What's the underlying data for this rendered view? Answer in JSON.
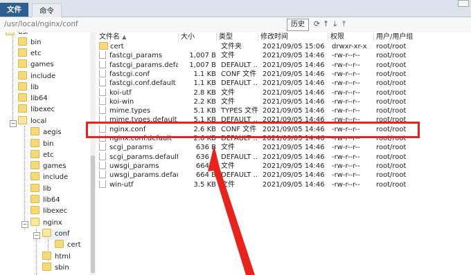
{
  "tabs": [
    {
      "label": "文件"
    },
    {
      "label": "命令"
    }
  ],
  "pathbar": {
    "path": "/usr/local/nginx/conf",
    "history_label": "历史",
    "icons": [
      "refresh-icon",
      "up-icon",
      "download-icon",
      "upload-icon"
    ]
  },
  "tree": {
    "items": [
      {
        "label": "usr",
        "name": "tree-item-usr"
      },
      {
        "label": "bin",
        "name": "tree-item-bin"
      },
      {
        "label": "etc",
        "name": "tree-item-etc"
      },
      {
        "label": "games",
        "name": "tree-item-games"
      },
      {
        "label": "include",
        "name": "tree-item-include"
      },
      {
        "label": "lib",
        "name": "tree-item-lib"
      },
      {
        "label": "lib64",
        "name": "tree-item-lib64"
      },
      {
        "label": "libexec",
        "name": "tree-item-libexec"
      },
      {
        "label": "local",
        "name": "tree-item-local"
      },
      {
        "label": "aegis",
        "name": "tree-item-aegis"
      },
      {
        "label": "bin",
        "name": "tree-item-local-bin"
      },
      {
        "label": "etc",
        "name": "tree-item-local-etc"
      },
      {
        "label": "games",
        "name": "tree-item-local-games"
      },
      {
        "label": "include",
        "name": "tree-item-local-include"
      },
      {
        "label": "lib",
        "name": "tree-item-local-lib"
      },
      {
        "label": "lib64",
        "name": "tree-item-local-lib64"
      },
      {
        "label": "libexec",
        "name": "tree-item-local-libexec"
      },
      {
        "label": "nginx",
        "name": "tree-item-nginx"
      },
      {
        "label": "conf",
        "name": "tree-item-conf"
      },
      {
        "label": "cert",
        "name": "tree-item-cert"
      },
      {
        "label": "html",
        "name": "tree-item-html"
      },
      {
        "label": "sbin",
        "name": "tree-item-sbin"
      }
    ]
  },
  "columns": {
    "name": "文件名",
    "sort_indicator": "▲",
    "size": "大小",
    "type": "类型",
    "mtime": "修改时间",
    "perm": "权限",
    "owner": "用户/用户组"
  },
  "files": [
    {
      "name": "cert",
      "size": "",
      "type": "文件夹",
      "mtime": "2021/09/05 15:06",
      "perm": "drwxr-xr-x",
      "owner": "root/root",
      "dir": true
    },
    {
      "name": "fastcgi_params",
      "size": "1,007 B",
      "type": "文件",
      "mtime": "2021/09/05 14:46",
      "perm": "-rw-r--r--",
      "owner": "root/root"
    },
    {
      "name": "fastcgi_params.defa...",
      "size": "1,007 B",
      "type": "DEFAULT ...",
      "mtime": "2021/09/05 14:46",
      "perm": "-rw-r--r--",
      "owner": "root/root"
    },
    {
      "name": "fastcgi.conf",
      "size": "1.1 KB",
      "type": "CONF 文件",
      "mtime": "2021/09/05 14:46",
      "perm": "-rw-r--r--",
      "owner": "root/root"
    },
    {
      "name": "fastcgi.conf.default",
      "size": "1.1 KB",
      "type": "DEFAULT ...",
      "mtime": "2021/09/05 14:46",
      "perm": "-rw-r--r--",
      "owner": "root/root"
    },
    {
      "name": "koi-utf",
      "size": "2.8 KB",
      "type": "文件",
      "mtime": "2021/09/05 14:46",
      "perm": "-rw-r--r--",
      "owner": "root/root"
    },
    {
      "name": "koi-win",
      "size": "2.2 KB",
      "type": "文件",
      "mtime": "2021/09/05 14:46",
      "perm": "-rw-r--r--",
      "owner": "root/root"
    },
    {
      "name": "mime.types",
      "size": "5.1 KB",
      "type": "TYPES 文件",
      "mtime": "2021/09/05 14:46",
      "perm": "-rw-r--r--",
      "owner": "root/root"
    },
    {
      "name": "mime.types.default",
      "size": "5.1 KB",
      "type": "DEFAULT ...",
      "mtime": "2021/09/05 14:46",
      "perm": "-rw-r--r--",
      "owner": "root/root"
    },
    {
      "name": "nginx.conf",
      "size": "2.6 KB",
      "type": "CONF 文件",
      "mtime": "2021/09/05 14:46",
      "perm": "-rw-r--r--",
      "owner": "root/root"
    },
    {
      "name": "nginx.conf.default",
      "size": "2.6 KB",
      "type": "DEFAULT ...",
      "mtime": "2021/09/05 14:46",
      "perm": "-rw-r--r--",
      "owner": "root/root"
    },
    {
      "name": "scgi_params",
      "size": "636 B",
      "type": "文件",
      "mtime": "2021/09/05 14:46",
      "perm": "-rw-r--r--",
      "owner": "root/root"
    },
    {
      "name": "scgi_params.default",
      "size": "636 B",
      "type": "DEFAULT ...",
      "mtime": "2021/09/05 14:46",
      "perm": "-rw-r--r--",
      "owner": "root/root"
    },
    {
      "name": "uwsgi_params",
      "size": "664 B",
      "type": "文件",
      "mtime": "2021/09/05 14:46",
      "perm": "-rw-r--r--",
      "owner": "root/root"
    },
    {
      "name": "uwsgi_params.default",
      "size": "664 B",
      "type": "DEFAULT ...",
      "mtime": "2021/09/05 14:46",
      "perm": "-rw-r--r--",
      "owner": "root/root"
    },
    {
      "name": "win-utf",
      "size": "3.5 KB",
      "type": "文件",
      "mtime": "2021/09/05 14:46",
      "perm": "-rw-r--r--",
      "owner": "root/root"
    }
  ],
  "annotation": {
    "highlight_color": "#e8231c"
  }
}
